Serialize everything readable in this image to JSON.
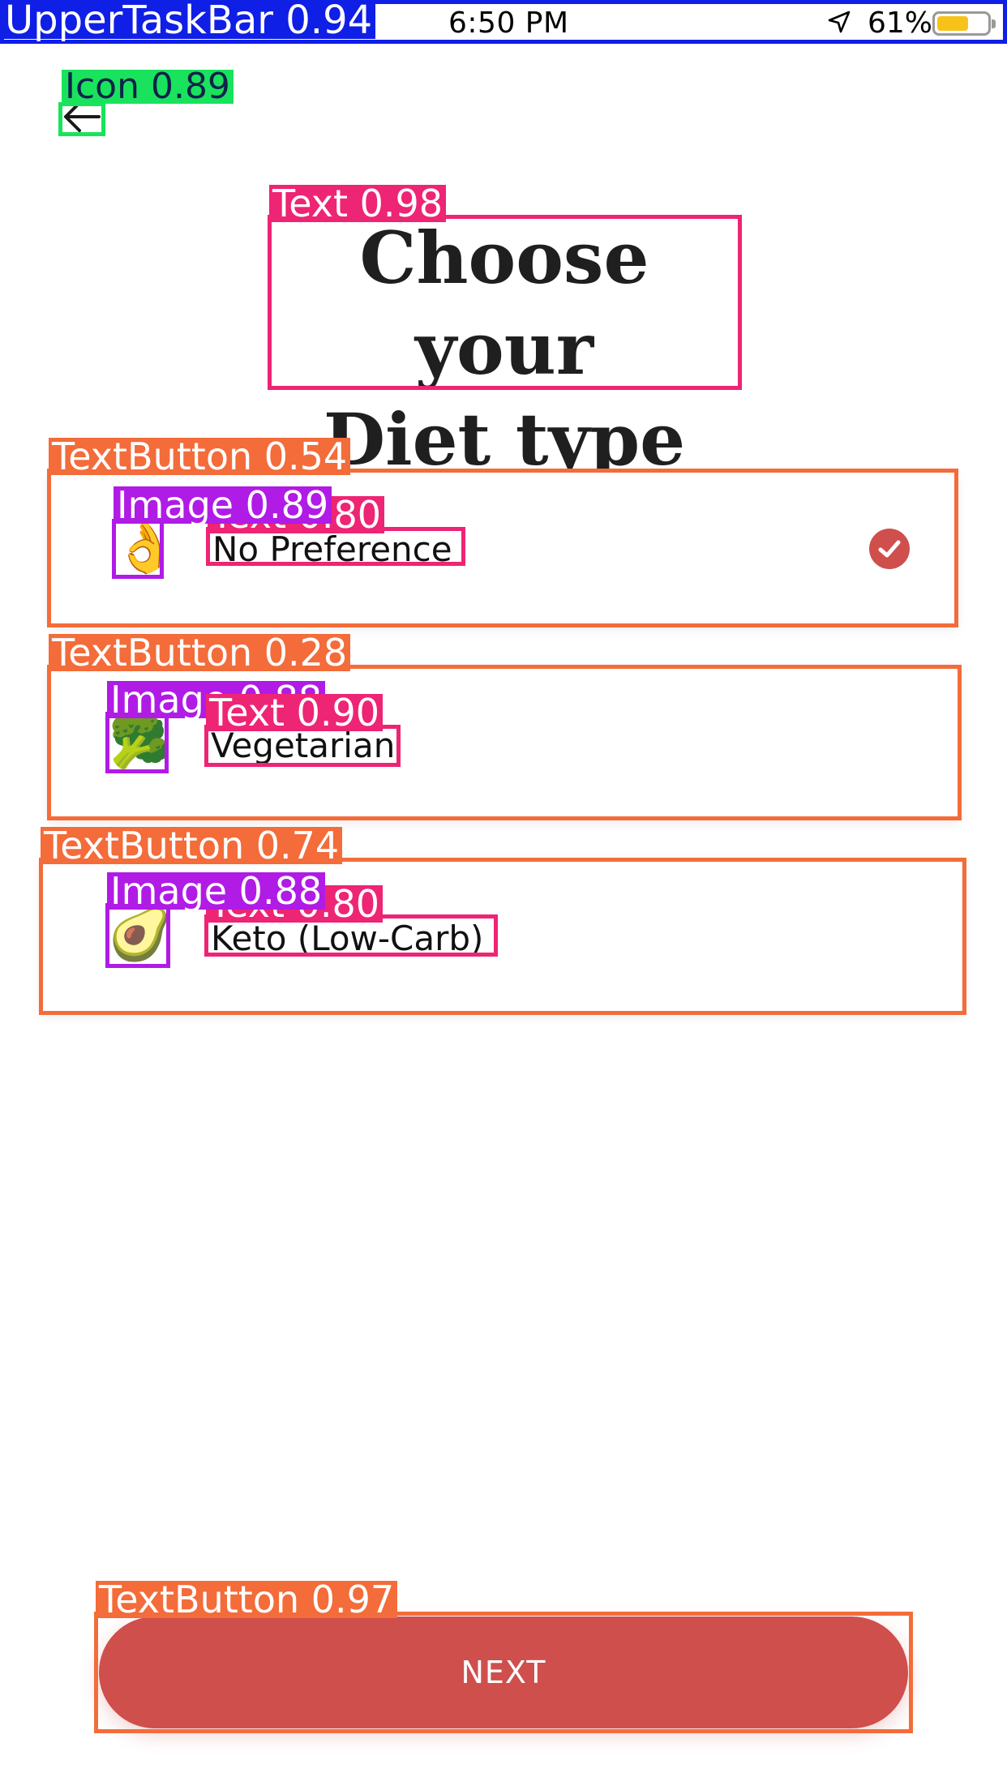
{
  "status_bar": {
    "time": "6:50 PM",
    "battery_percent": "61%",
    "battery_level": 0.61,
    "location_icon": "location-arrow-icon",
    "battery_color": "#f7c31a"
  },
  "header": {
    "back_icon": "arrow-left-icon",
    "title_line1": "Choose your",
    "title_line2": "Diet type"
  },
  "options": [
    {
      "emoji": "👌",
      "label": "No Preference",
      "selected": true
    },
    {
      "emoji": "🥦",
      "label": "Vegetarian",
      "selected": false
    },
    {
      "emoji": "🥑",
      "label": "Keto (Low-Carb)",
      "selected": false
    }
  ],
  "selected_check_icon": "check-circle-icon",
  "next_button": {
    "label": "NEXT"
  },
  "accent_color": "#cf4f4d",
  "overlay_tags": {
    "upper_task_bar": "UpperTaskBar  0.94",
    "icon_back": "Icon  0.89",
    "text_title": "Text  0.98",
    "textbutton_1": "TextButton  0.54",
    "image_1": "Image  0.89",
    "text_1": "Text  0.80",
    "textbutton_2": "TextButton  0.28",
    "image_2": "Image  0.88",
    "text_2": "Text  0.90",
    "textbutton_3": "TextButton  0.74",
    "image_3": "Image  0.88",
    "text_3": "Text  0.80",
    "textbutton_next": "TextButton  0.97"
  }
}
